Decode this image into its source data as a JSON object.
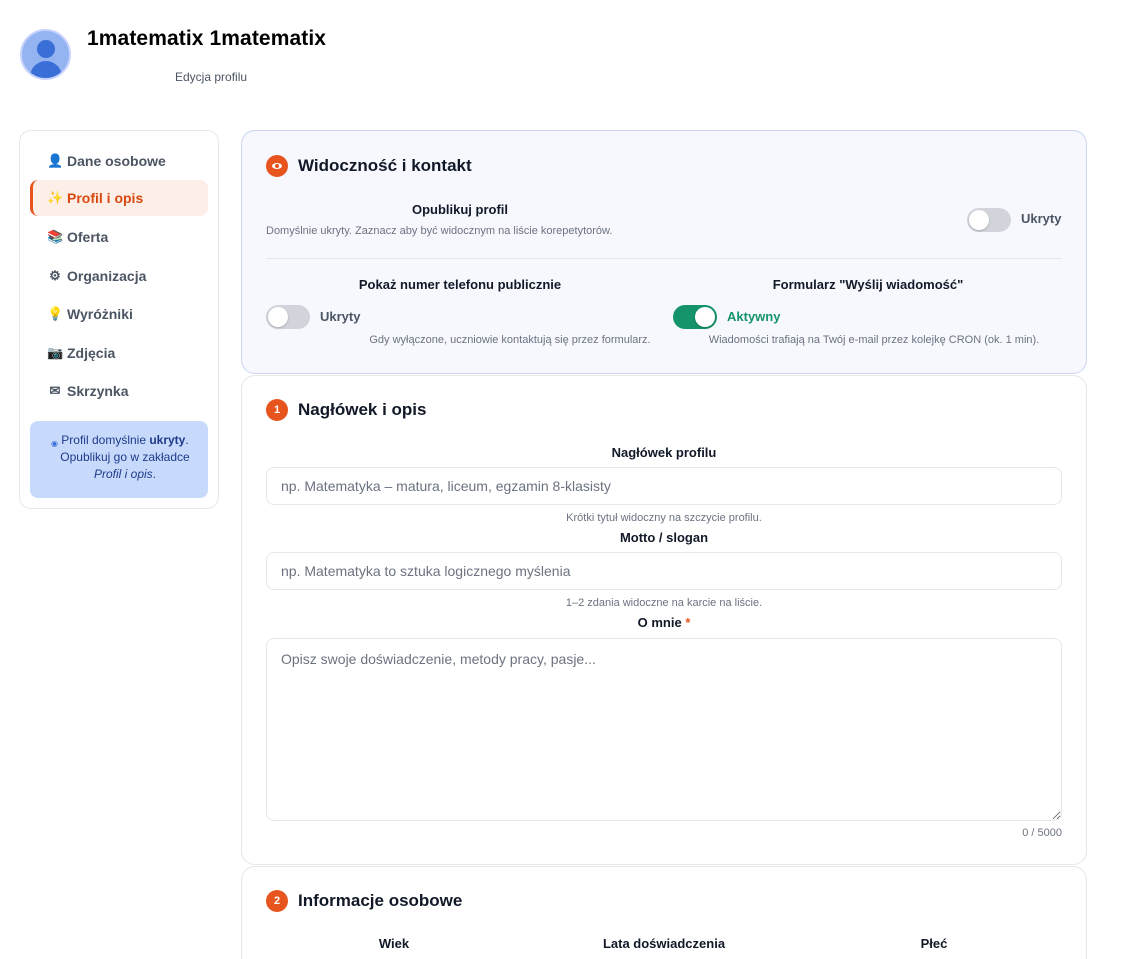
{
  "header": {
    "name": "1matematix 1matematix",
    "subtitle": "Edycja profilu"
  },
  "sidebar": {
    "items": [
      {
        "icon": "👤",
        "icon_name": "person-icon",
        "label": "Dane osobowe"
      },
      {
        "icon": "✨",
        "icon_name": "sparkle-icon",
        "label": "Profil i opis",
        "active": true
      },
      {
        "icon": "📚",
        "icon_name": "books-icon",
        "label": "Oferta"
      },
      {
        "icon": "⚙",
        "icon_name": "gear-icon",
        "label": "Organizacja"
      },
      {
        "icon": "💡",
        "icon_name": "lightbulb-icon",
        "label": "Wyróżniki"
      },
      {
        "icon": "📷",
        "icon_name": "camera-icon",
        "label": "Zdjęcia"
      },
      {
        "icon": "✉",
        "icon_name": "envelope-icon",
        "label": "Skrzynka"
      }
    ],
    "note": {
      "text_before": "Profil domyślnie ",
      "text_bold": "ukryty",
      "text_mid": ". Opublikuj go w zakładce ",
      "text_italic": "Profil i opis",
      "text_after": "."
    }
  },
  "visibility": {
    "title": "Widoczność i kontakt",
    "publish": {
      "label": "Opublikuj profil",
      "hint": "Domyślnie ukryty. Zaznacz aby być widocznym na liście korepetytorów.",
      "state_label": "Ukryty",
      "on": false
    },
    "phone": {
      "label": "Pokaż numer telefonu publicznie",
      "state_label": "Ukryty",
      "hint": "Gdy wyłączone, uczniowie kontaktują się przez formularz.",
      "on": false
    },
    "form": {
      "label": "Formularz \"Wyślij wiadomość\"",
      "state_label": "Aktywny",
      "hint": "Wiadomości trafiają na Twój e-mail przez kolejkę CRON (ok. 1 min).",
      "on": true
    }
  },
  "headline": {
    "number": "1",
    "title": "Nagłówek i opis",
    "profile_header": {
      "label": "Nagłówek profilu",
      "placeholder": "np. Matematyka – matura, liceum, egzamin 8-klasisty",
      "value": "",
      "hint": "Krótki tytuł widoczny na szczycie profilu."
    },
    "motto": {
      "label": "Motto / slogan",
      "placeholder": "np. Matematyka to sztuka logicznego myślenia",
      "value": "",
      "hint": "1–2 zdania widoczne na karcie na liście."
    },
    "about": {
      "label": "O mnie",
      "required_mark": "*",
      "placeholder": "Opisz swoje doświadczenie, metody pracy, pasje...",
      "value": "",
      "counter": "0 / 5000"
    }
  },
  "personal": {
    "number": "2",
    "title": "Informacje osobowe",
    "columns": [
      "Wiek",
      "Lata doświadczenia",
      "Płeć"
    ]
  },
  "colors": {
    "accent": "#e8541e",
    "success": "#15936a",
    "note_bg": "#c7dafc"
  }
}
